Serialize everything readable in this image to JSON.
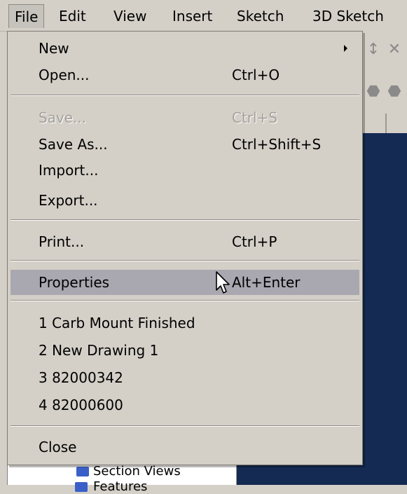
{
  "menubar": {
    "items": [
      "File",
      "Edit",
      "View",
      "Insert",
      "Sketch",
      "3D Sketch"
    ]
  },
  "file_menu": {
    "new": {
      "label": "New"
    },
    "open": {
      "label": "Open...",
      "shortcut": "Ctrl+O"
    },
    "save": {
      "label": "Save...",
      "shortcut": "Ctrl+S"
    },
    "save_as": {
      "label": "Save As...",
      "shortcut": "Ctrl+Shift+S"
    },
    "import": {
      "label": "Import..."
    },
    "export": {
      "label": "Export..."
    },
    "print": {
      "label": "Print...",
      "shortcut": "Ctrl+P"
    },
    "properties": {
      "label": "Properties",
      "shortcut": "Alt+Enter"
    },
    "recent": [
      "1 Carb Mount Finished",
      "2 New Drawing 1",
      "3 82000342",
      "4 82000600"
    ],
    "close": {
      "label": "Close"
    }
  },
  "background": {
    "tree_item": "Section Views",
    "tree_item_2": "Features"
  },
  "colors": {
    "menu_bg": "#d4d0c8",
    "highlight": "#a9a7b0",
    "viewport": "#142a52",
    "disabled_text": "#a4a09a"
  }
}
